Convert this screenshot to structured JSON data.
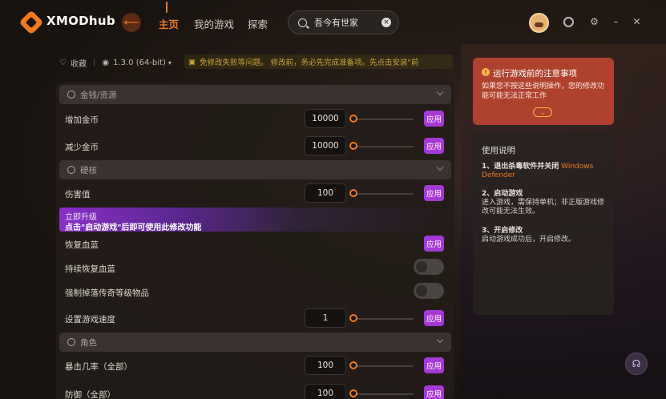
{
  "app": {
    "brand": "XMODhub"
  },
  "nav": {
    "back": "⟵",
    "home": "主页",
    "my_games": "我的游戏",
    "explore": "探索"
  },
  "search": {
    "value": "吾今有世家",
    "clear": "×"
  },
  "infobar": {
    "favorite": "收藏",
    "version": "1.3.0 (64-bit)",
    "warning": "免修改失败等问题。        修改前，务必先完成准备项。先点击安装\"前"
  },
  "sections": [
    {
      "title": "金钱/资源"
    },
    {
      "title": "硬核"
    },
    {
      "title": "角色"
    }
  ],
  "rows": {
    "add_gold": {
      "label": "增加金币",
      "value": "10000",
      "apply": "应用"
    },
    "sub_gold": {
      "label": "减少金币",
      "value": "10000",
      "apply": "应用"
    },
    "damage": {
      "label": "伤害值",
      "value": "100",
      "apply": "应用"
    },
    "restore_hp": {
      "label": "恢复血蓝",
      "apply": "应用"
    },
    "keep_hp": {
      "label": "持续恢复血蓝"
    },
    "force_drop": {
      "label": "强制掉落传奇等级物品"
    },
    "speed": {
      "label": "设置游戏速度",
      "value": "1",
      "apply": "应用"
    },
    "crit": {
      "label": "暴击几率（全部）",
      "value": "100",
      "apply": "应用"
    },
    "defense": {
      "label": "防御（全部）",
      "value": "100",
      "apply": "应用"
    }
  },
  "upgrade": {
    "line1": "立即升级",
    "line2": "点击\"启动游戏\"后即可使用此修改功能"
  },
  "warncard": {
    "title": "运行游戏前的注意事项",
    "body": "如果您不按这些说明操作，您的修改功能可能无法正常工作",
    "icon": "!"
  },
  "guide": {
    "title": "使用说明",
    "step1_title": "1、退出杀毒软件并关闭",
    "step1_hl": "Windows Defender",
    "step2_title": "2、启动游戏",
    "step2_body": "进入游戏，需保持单机；非正版游戏修改可能无法生效。",
    "step3_title": "3、开启修改",
    "step3_body": "启动游戏成功后，开启修改。"
  },
  "colors": {
    "accent": "#f07a1e",
    "apply": "#a63ad6",
    "warn": "#b0412f"
  }
}
